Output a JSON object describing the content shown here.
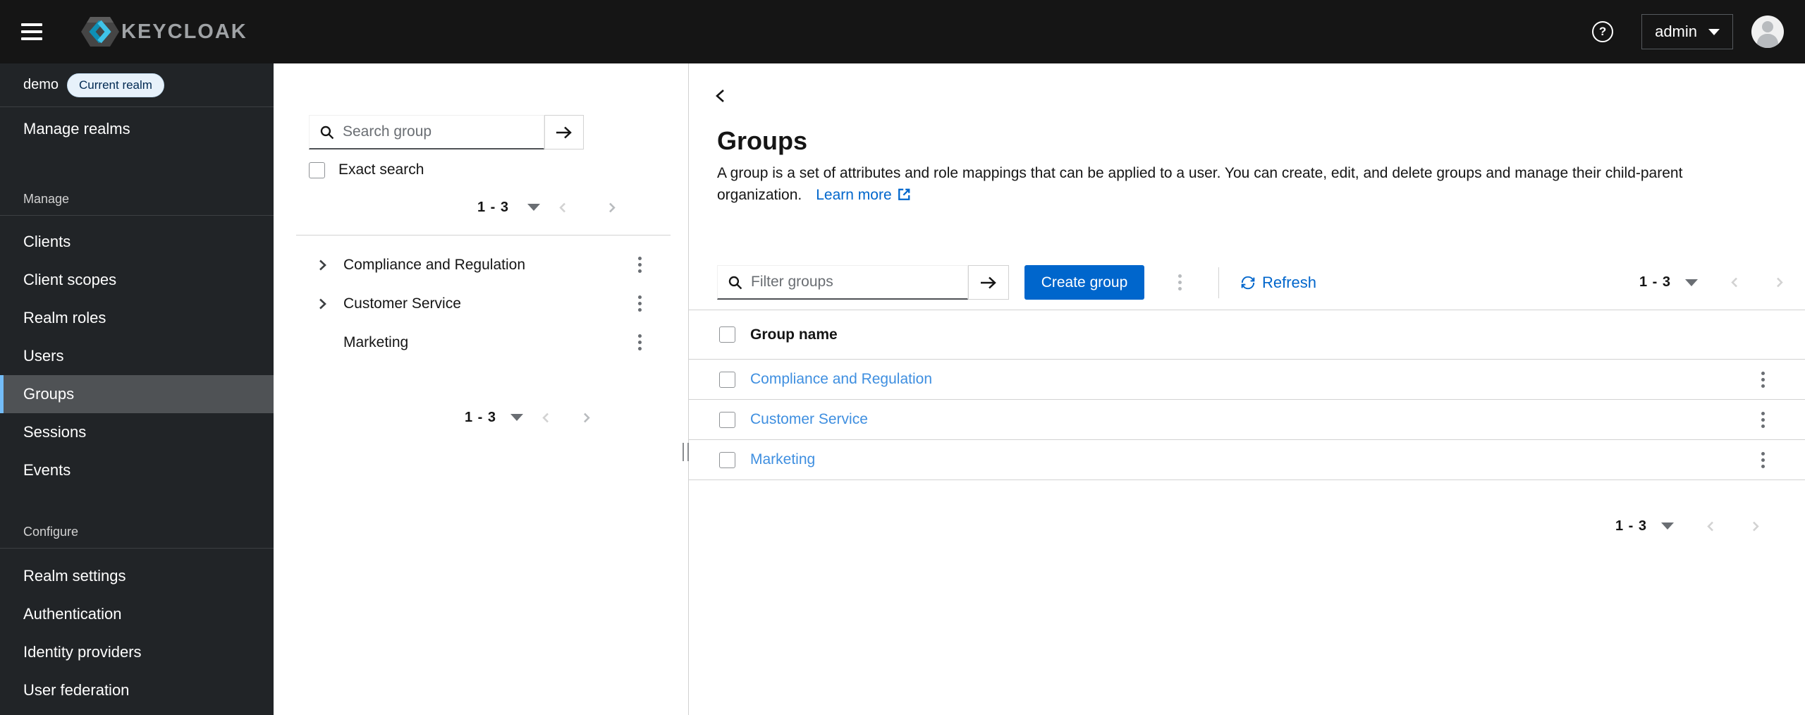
{
  "masthead": {
    "brand_text": "KEYCLOAK",
    "username": "admin"
  },
  "sidebar": {
    "realm_name": "demo",
    "realm_badge": "Current realm",
    "manage_realms_label": "Manage realms",
    "manage_section_label": "Manage",
    "configure_section_label": "Configure",
    "manage_items": [
      "Clients",
      "Client scopes",
      "Realm roles",
      "Users",
      "Groups",
      "Sessions",
      "Events"
    ],
    "configure_items": [
      "Realm settings",
      "Authentication",
      "Identity providers",
      "User federation"
    ],
    "active_item": "Groups"
  },
  "groups_tree_panel": {
    "search_placeholder": "Search group",
    "exact_search_label": "Exact search",
    "pagination_top": {
      "range": "1 - 3"
    },
    "items": [
      {
        "name": "Compliance and Regulation",
        "expandable": true
      },
      {
        "name": "Customer Service",
        "expandable": true
      },
      {
        "name": "Marketing",
        "expandable": false
      }
    ],
    "pagination_bottom": {
      "range": "1 - 3"
    }
  },
  "main": {
    "title": "Groups",
    "description": "A group is a set of attributes and role mappings that can be applied to a user. You can create, edit, and delete groups and manage their child-parent organization.",
    "learn_more_label": "Learn more",
    "toolbar": {
      "filter_placeholder": "Filter groups",
      "create_button_label": "Create group",
      "refresh_label": "Refresh",
      "pagination": {
        "range": "1 - 3"
      }
    },
    "table": {
      "header": "Group name",
      "rows": [
        "Compliance and Regulation",
        "Customer Service",
        "Marketing"
      ]
    },
    "pagination_bottom": {
      "range": "1 - 3"
    }
  },
  "icons": {
    "masthead": [
      "hamburger-menu-icon",
      "keycloak-logo",
      "question-circle-icon",
      "caret-down-icon",
      "user-avatar"
    ],
    "search": "search-icon",
    "submit": "arrow-right-icon",
    "external_link": "external-link-icon",
    "refresh": "sync-icon",
    "row_actions": "kebab-menu-icon",
    "tree_expand": "chevron-right-icon",
    "drawer_collapse": "chevron-left-icon",
    "pagination": [
      "caret-down-icon",
      "chevron-left-icon",
      "chevron-right-icon"
    ]
  },
  "colors": {
    "masthead_bg": "#151515",
    "sidebar_bg": "#212427",
    "active_nav_bg": "#4f5255",
    "active_nav_accent": "#73bcf7",
    "primary_blue": "#0066cc",
    "table_link_blue": "#3f8fe0",
    "badge_bg": "#e7f1fa",
    "badge_text": "#002952",
    "border_gray": "#d2d2d2"
  }
}
